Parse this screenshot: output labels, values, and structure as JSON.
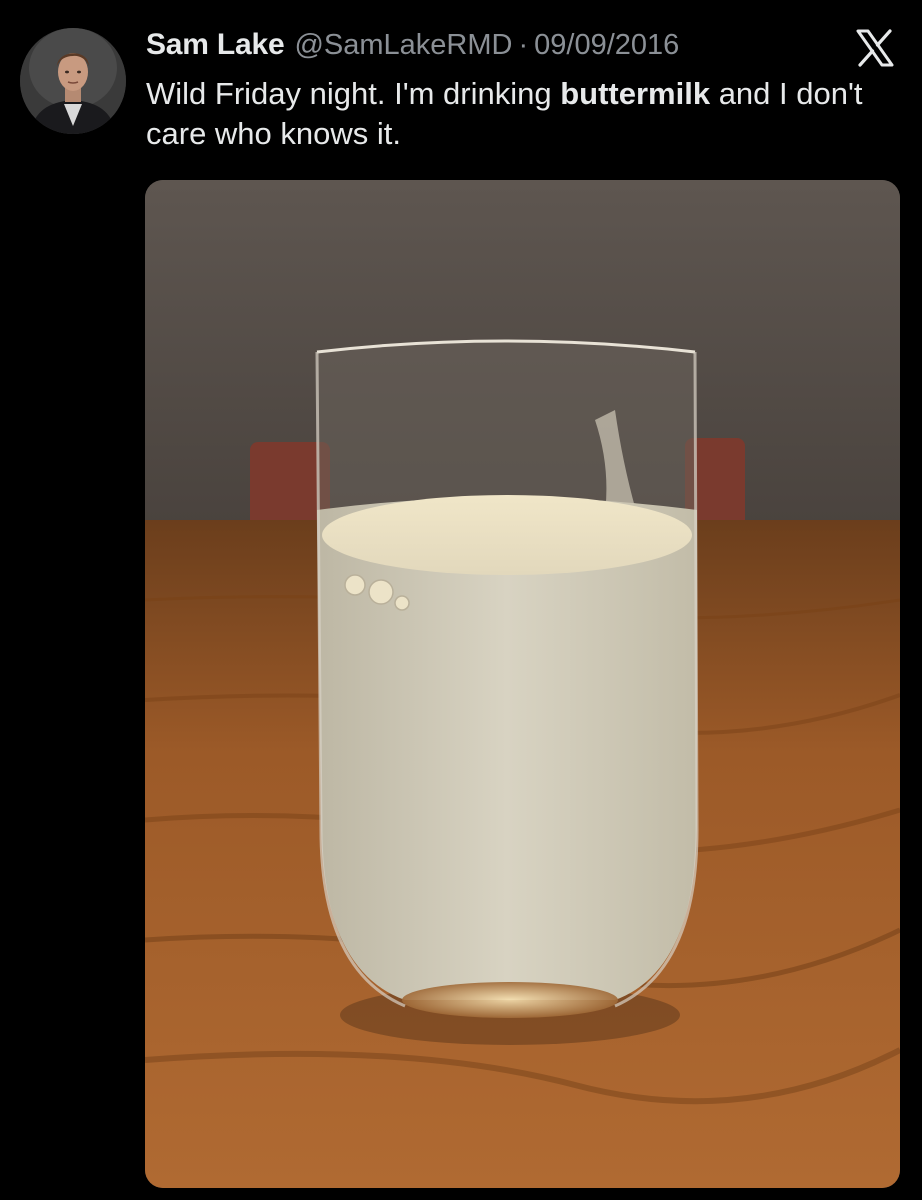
{
  "tweet": {
    "author_name": "Sam Lake",
    "handle": "@SamLakeRMD",
    "separator": "·",
    "date": "09/09/2016",
    "text_part1": "Wild Friday night. I'm drinking ",
    "text_bold": "buttermilk",
    "text_part2": " and I don't care who knows it."
  },
  "icons": {
    "platform": "x-logo-icon",
    "avatar": "profile-photo"
  },
  "media": {
    "subject": "glass-of-buttermilk-photo"
  },
  "colors": {
    "background": "#000000",
    "text_primary": "#e7e9ea",
    "text_secondary": "#8b9096"
  }
}
